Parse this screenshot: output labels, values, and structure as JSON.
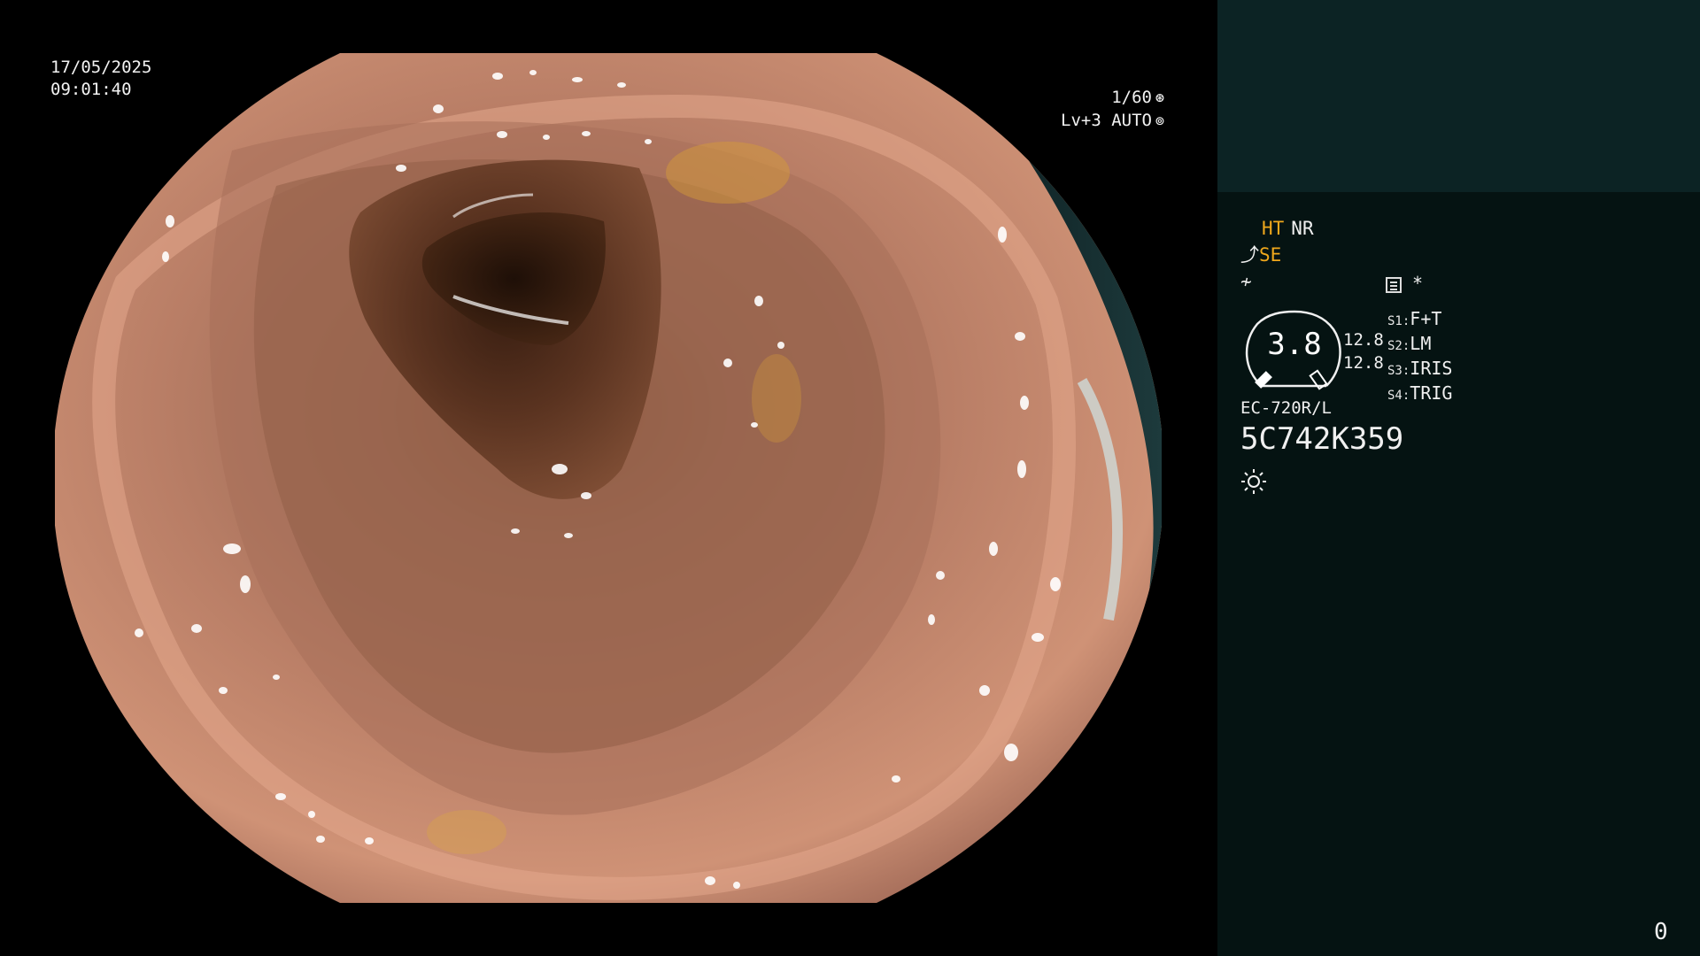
{
  "overlay": {
    "date": "17/05/2025",
    "time": "09:01:40",
    "shutter": "1/60",
    "shutter_icon": "shutter-icon",
    "exposure": "Lv+3 AUTO",
    "exposure_icon": "iris-icon"
  },
  "panel": {
    "mode_ht": "HT",
    "mode_nr": "NR",
    "mode_se": "SE",
    "se_icon": "scope-tip-icon",
    "enhance_icon": "enhance-icon",
    "memo_icon": "memo-icon",
    "memo_mark": "*",
    "zoom_value": "3.8",
    "focus_values": [
      "12.8",
      "12.8"
    ],
    "switches": [
      {
        "key": "S1:",
        "value": "F+T"
      },
      {
        "key": "S2:",
        "value": "LM"
      },
      {
        "key": "S3:",
        "value": "IRIS"
      },
      {
        "key": "S4:",
        "value": "TRIG"
      }
    ],
    "scope_model": "EC-720R/L",
    "scope_serial": "5C742K359",
    "light_icon": "light-source-icon",
    "counter": "0"
  },
  "colors": {
    "background": "#000000",
    "panel_top": "#0c2324",
    "panel_bottom": "#051312",
    "amber": "#f0a81c",
    "mucosa": "#c98b73"
  }
}
